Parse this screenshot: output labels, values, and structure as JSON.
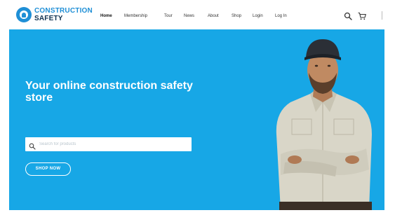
{
  "logo": {
    "line1": "CONSTRUCTION",
    "line2": "SAFETY"
  },
  "nav": {
    "items": [
      {
        "label": "Home",
        "active": true
      },
      {
        "label": "Membership",
        "active": false
      },
      {
        "label": "Tour",
        "active": false
      },
      {
        "label": "News",
        "active": false
      },
      {
        "label": "About",
        "active": false
      },
      {
        "label": "Shop",
        "active": false
      },
      {
        "label": "Login",
        "active": false
      },
      {
        "label": "Log In",
        "active": false
      }
    ]
  },
  "header_icons": {
    "search": "search-icon",
    "cart": "cart-icon"
  },
  "hero": {
    "title": "Your online construction safety store",
    "search_placeholder": "Search for products",
    "shop_button": "SHOP NOW"
  },
  "colors": {
    "brand_blue": "#1f8fd6",
    "brand_navy": "#10314f",
    "hero_background": "#17a7e6",
    "text_white": "#ffffff"
  }
}
